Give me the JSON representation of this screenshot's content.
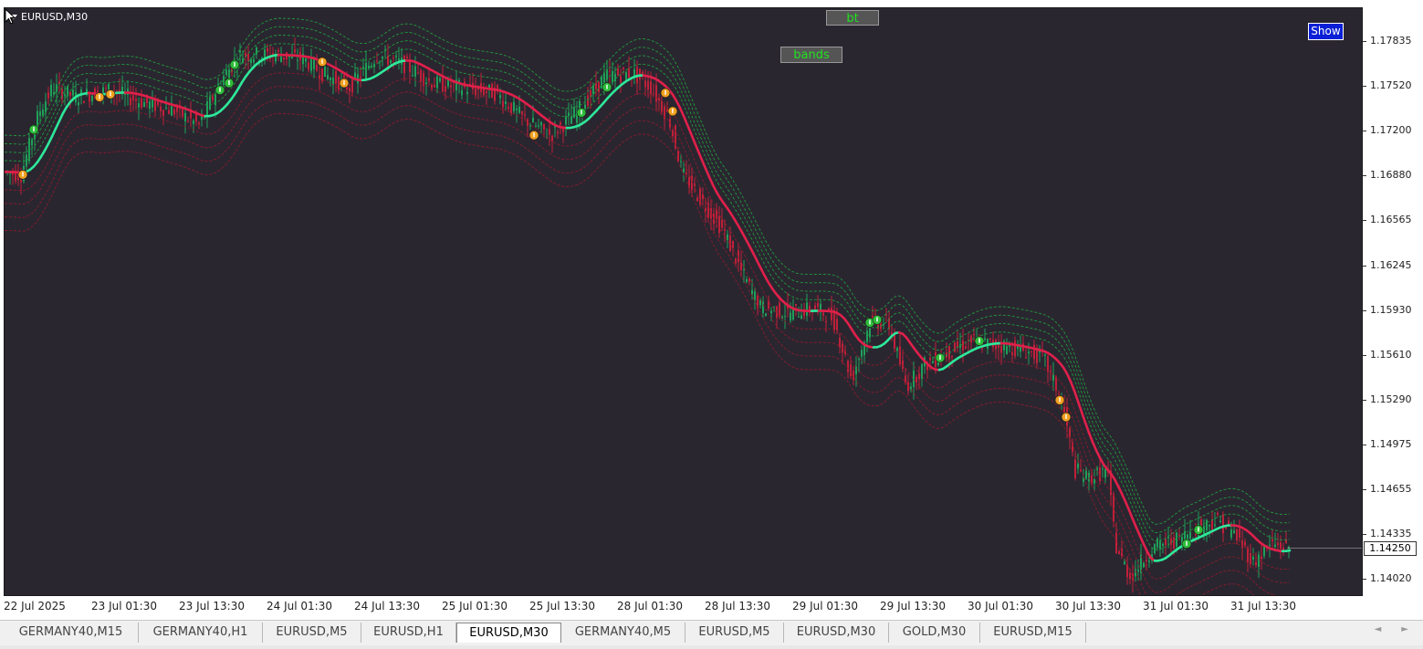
{
  "chart": {
    "symbol": "EURUSD,M30",
    "buttons": {
      "bt": "bt",
      "bands": "bands",
      "show": "Show"
    },
    "current_price": "1.14250",
    "y_ticks": [
      "1.17835",
      "1.17520",
      "1.17200",
      "1.16880",
      "1.16565",
      "1.16245",
      "1.15930",
      "1.15610",
      "1.15290",
      "1.14975",
      "1.14655",
      "1.14335",
      "1.14020"
    ],
    "x_ticks": [
      "22 Jul 2025",
      "23 Jul 01:30",
      "23 Jul 13:30",
      "24 Jul 01:30",
      "24 Jul 13:30",
      "25 Jul 01:30",
      "25 Jul 13:30",
      "28 Jul 01:30",
      "28 Jul 13:30",
      "29 Jul 01:30",
      "29 Jul 13:30",
      "30 Jul 01:30",
      "30 Jul 13:30",
      "31 Jul 01:30",
      "31 Jul 13:30"
    ],
    "colors": {
      "background": "#2a2630",
      "bull_candle": "#1fa05a",
      "bear_candle": "#c0203a",
      "ma_up": "#2ee89a",
      "ma_down": "#e0204a",
      "band_upper": "#1f9a3a",
      "band_lower": "#8a1a2a",
      "buy_signal": "#2ebd3a",
      "sell_signal": "#f0a020"
    }
  },
  "chart_data": {
    "type": "line",
    "title": "",
    "xlabel": "",
    "ylabel": "",
    "ylim": [
      1.139,
      1.1805
    ],
    "series": [
      {
        "x": [
          "22 Jul 2025",
          "23 Jul 01:30",
          "23 Jul 13:30",
          "24 Jul 01:30",
          "24 Jul 13:30",
          "25 Jul 01:30",
          "25 Jul 13:30",
          "28 Jul 01:30",
          "28 Jul 13:30",
          "29 Jul 01:30",
          "29 Jul 13:30",
          "30 Jul 01:30",
          "30 Jul 13:30",
          "31 Jul 01:30",
          "31 Jul 13:30"
        ],
        "values": [
          1.1693,
          1.1746,
          1.1726,
          1.1772,
          1.1762,
          1.1755,
          1.1735,
          1.175,
          1.1665,
          1.1597,
          1.1575,
          1.155,
          1.1558,
          1.1435,
          1.1441
        ]
      }
    ]
  },
  "tabs": [
    {
      "label": "GERMANY40,M15"
    },
    {
      "label": "GERMANY40,H1"
    },
    {
      "label": "EURUSD,M5"
    },
    {
      "label": "EURUSD,H1"
    },
    {
      "label": "EURUSD,M30",
      "active": true
    },
    {
      "label": "GERMANY40,M5"
    },
    {
      "label": "EURUSD,M5"
    },
    {
      "label": "EURUSD,M30"
    },
    {
      "label": "GOLD,M30"
    },
    {
      "label": "EURUSD,M15"
    }
  ],
  "icons": {
    "scroll_left": "◄",
    "scroll_right": "►",
    "dropdown": "chevron-down-icon"
  }
}
